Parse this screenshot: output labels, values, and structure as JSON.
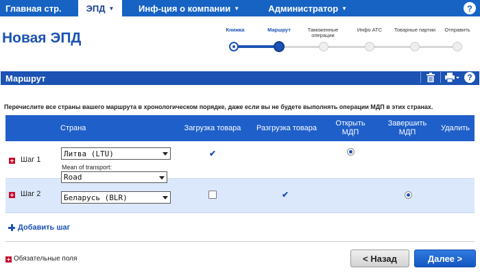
{
  "nav": {
    "items": [
      {
        "label": "Главная стр.",
        "caret": ""
      },
      {
        "label": "ЭПД",
        "caret": "▼"
      },
      {
        "label": "Инф-ция о компании",
        "caret": "▼"
      },
      {
        "label": "Администратор",
        "caret": "▼"
      }
    ],
    "help": "?"
  },
  "page": {
    "title": "Новая ЭПД"
  },
  "stepper": {
    "steps": [
      {
        "label": "Книжка",
        "state": "done"
      },
      {
        "label": "Маршрут",
        "state": "current"
      },
      {
        "label": "Таможенные операции",
        "state": "pending"
      },
      {
        "label": "Инфо АТС",
        "state": "pending"
      },
      {
        "label": "Товарные партии",
        "state": "pending"
      },
      {
        "label": "Отправить",
        "state": "pending"
      }
    ]
  },
  "panel": {
    "title": "Маршрут",
    "help": "?"
  },
  "intro": "Перечислите все страны вашего маршрута в хронологическом порядке, даже если вы не будете выполнять операции МДП в этих странах.",
  "table": {
    "headers": {
      "country": "Страна",
      "loading": "Загрузка товара",
      "unloading": "Разгрузка товара",
      "open": "Открыть МДП",
      "close": "Завершить МДП",
      "delete": "Удалить"
    },
    "rows": [
      {
        "step": "Шаг 1",
        "country": "Литва (LTU)",
        "mot_label": "Mean of transport:",
        "mot_value": "Road",
        "loading": "checked",
        "unloading": "none",
        "open": "selected",
        "close": "none"
      },
      {
        "step": "Шаг 2",
        "country": "Беларусь (BLR)",
        "loading": "unchecked",
        "unloading": "checked",
        "open": "none",
        "close": "selected"
      }
    ]
  },
  "actions": {
    "add_step": "Добавить шаг",
    "required_note": "Обязательные поля",
    "back": "< Назад",
    "next": "Далее >"
  },
  "colors": {
    "brand_blue": "#1b52b3",
    "nav_blue": "#1763c4",
    "required_red": "#c8102e"
  }
}
